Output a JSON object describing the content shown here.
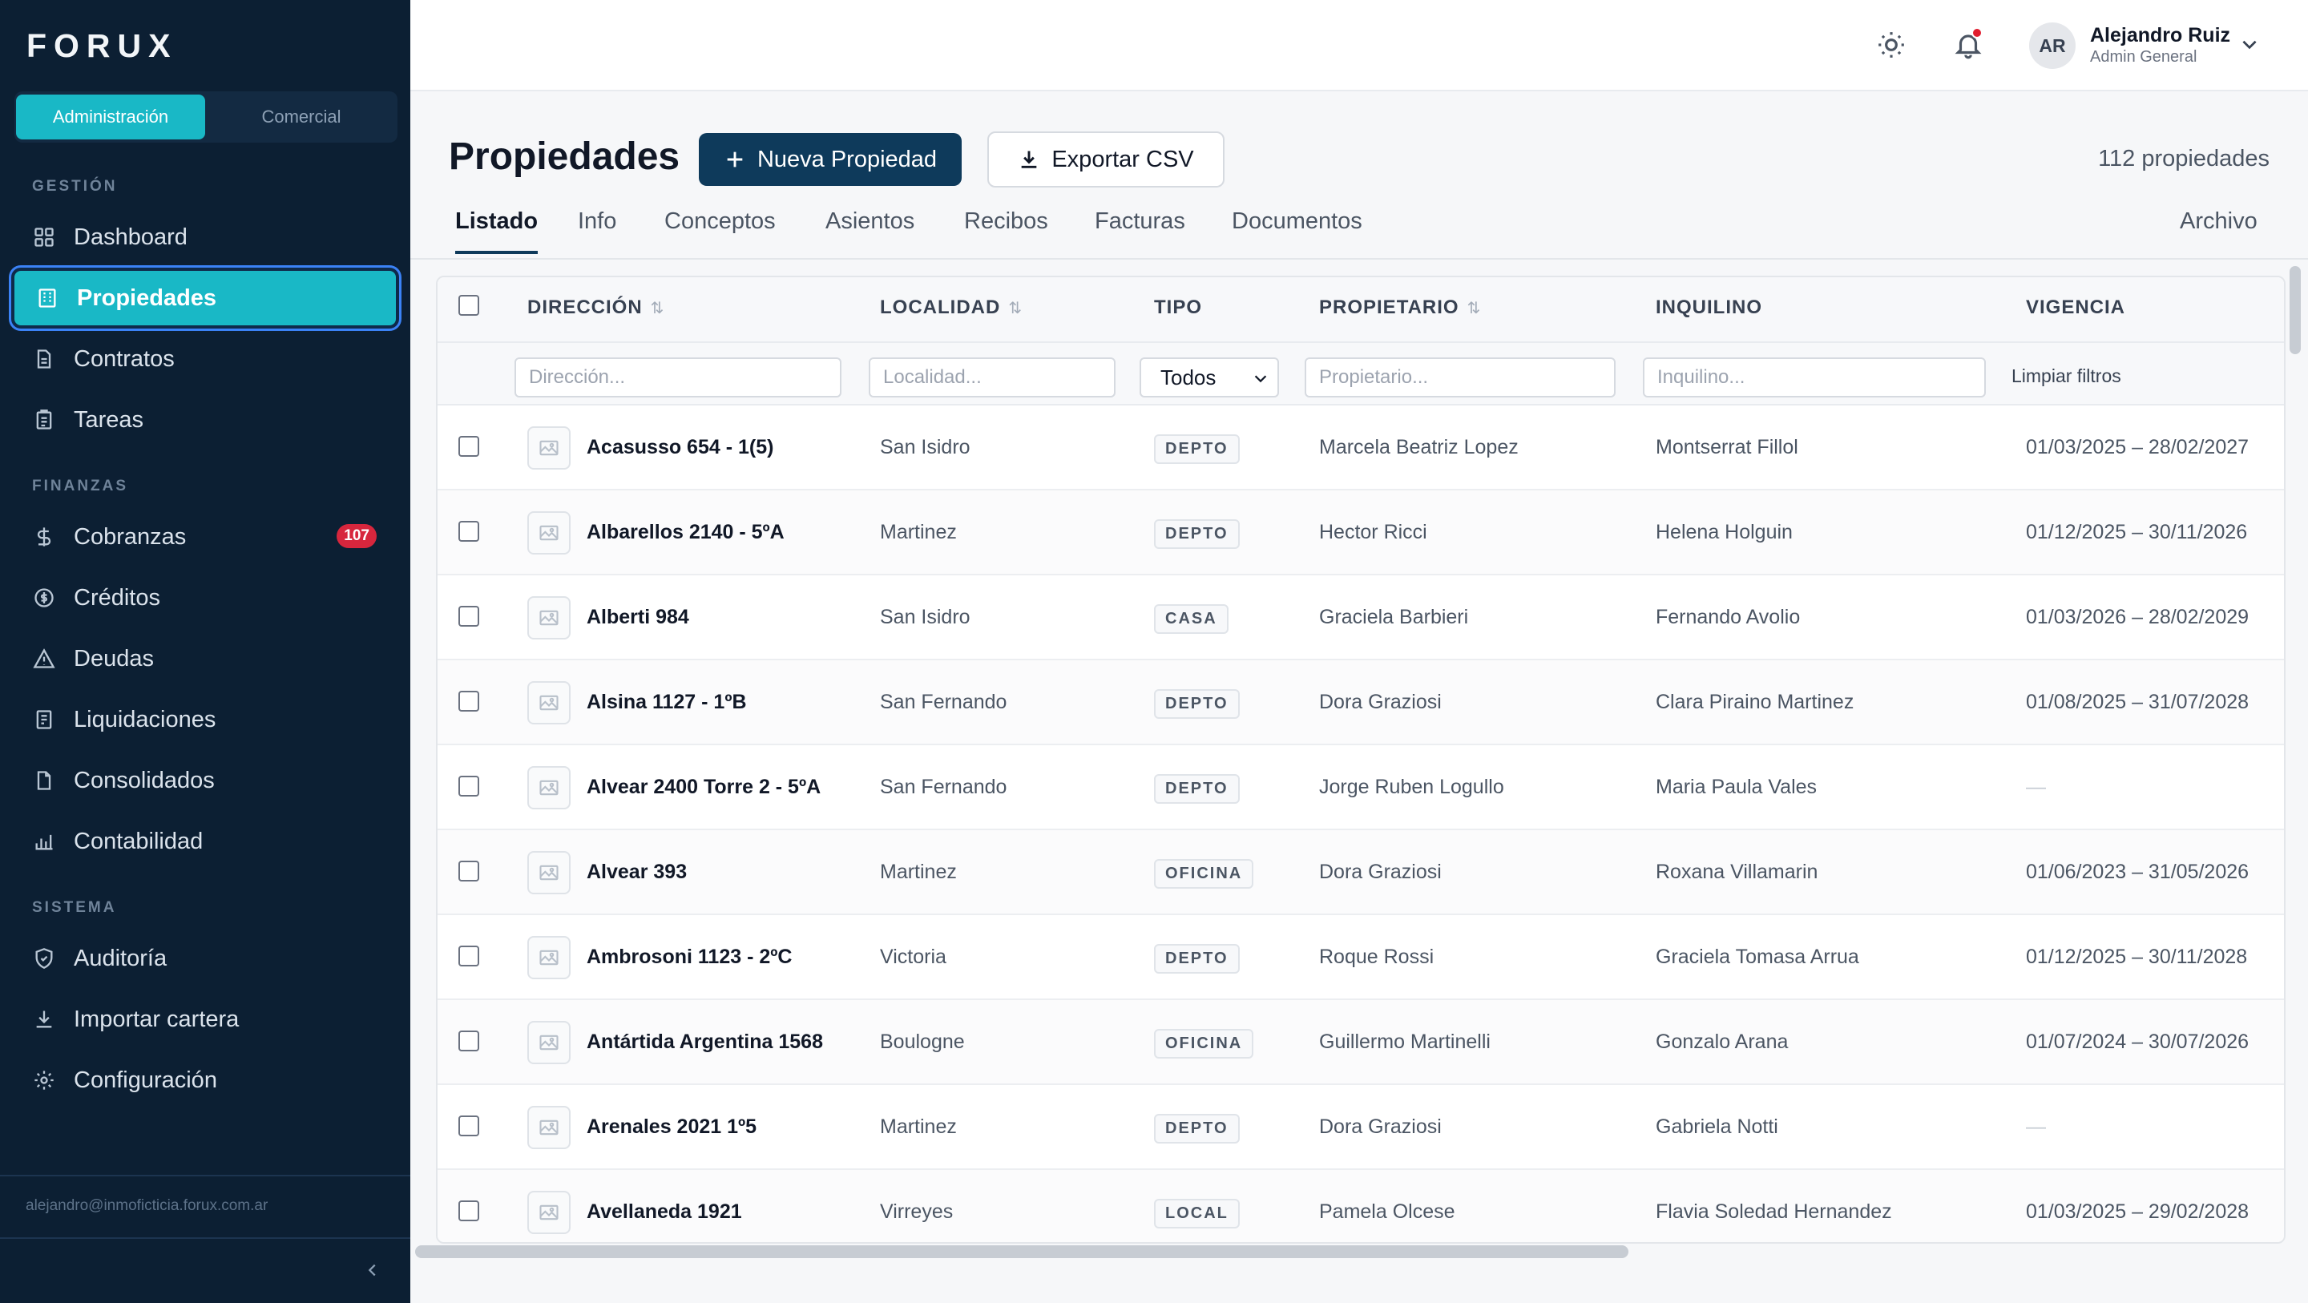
{
  "app": {
    "logo": "FORUX"
  },
  "sidebar": {
    "segments": [
      {
        "label": "Administración"
      },
      {
        "label": "Comercial"
      }
    ],
    "sections": {
      "gestion": "GESTIÓN",
      "finanzas": "FINANZAS",
      "sistema": "SISTEMA"
    },
    "items": [
      {
        "label": "Dashboard",
        "icon": "grid-icon"
      },
      {
        "label": "Propiedades",
        "icon": "building-icon"
      },
      {
        "label": "Contratos",
        "icon": "document-icon"
      },
      {
        "label": "Tareas",
        "icon": "clipboard-icon"
      },
      {
        "label": "Cobranzas",
        "icon": "dollar-icon",
        "badge": "107"
      },
      {
        "label": "Créditos",
        "icon": "coin-icon"
      },
      {
        "label": "Deudas",
        "icon": "warning-icon"
      },
      {
        "label": "Liquidaciones",
        "icon": "receipt-icon"
      },
      {
        "label": "Consolidados",
        "icon": "file-icon"
      },
      {
        "label": "Contabilidad",
        "icon": "bar-chart-icon"
      },
      {
        "label": "Auditoría",
        "icon": "shield-icon"
      },
      {
        "label": "Importar cartera",
        "icon": "download-icon"
      },
      {
        "label": "Configuración",
        "icon": "gear-icon"
      }
    ],
    "email": "alejandro@inmoficticia.forux.com.ar"
  },
  "user": {
    "initials": "AR",
    "name": "Alejandro Ruiz",
    "role": "Admin General"
  },
  "page": {
    "title": "Propiedades",
    "new_button": "Nueva Propiedad",
    "export_button": "Exportar CSV",
    "count": "112 propiedades"
  },
  "tabs": [
    "Listado",
    "Info",
    "Conceptos",
    "Asientos",
    "Recibos",
    "Facturas",
    "Documentos"
  ],
  "archive_tab": "Archivo",
  "table": {
    "columns": [
      "DIRECCIÓN",
      "LOCALIDAD",
      "TIPO",
      "PROPIETARIO",
      "INQUILINO",
      "VIGENCIA"
    ],
    "filters": {
      "direccion": "Dirección...",
      "localidad": "Localidad...",
      "tipo": "Todos",
      "propietario": "Propietario...",
      "inquilino": "Inquilino...",
      "clear": "Limpiar filtros"
    },
    "rows": [
      {
        "direccion": "Acasusso 654 - 1(5)",
        "localidad": "San Isidro",
        "tipo": "DEPTO",
        "propietario": "Marcela Beatriz Lopez",
        "inquilino": "Montserrat Fillol",
        "vigencia": "01/03/2025 – 28/02/2027"
      },
      {
        "direccion": "Albarellos 2140 - 5ºA",
        "localidad": "Martinez",
        "tipo": "DEPTO",
        "propietario": "Hector Ricci",
        "inquilino": "Helena Holguin",
        "vigencia": "01/12/2025 – 30/11/2026"
      },
      {
        "direccion": "Alberti 984",
        "localidad": "San Isidro",
        "tipo": "CASA",
        "propietario": "Graciela Barbieri",
        "inquilino": "Fernando Avolio",
        "vigencia": "01/03/2026 – 28/02/2029"
      },
      {
        "direccion": "Alsina 1127 - 1ºB",
        "localidad": "San Fernando",
        "tipo": "DEPTO",
        "propietario": "Dora Graziosi",
        "inquilino": "Clara Piraino Martinez",
        "vigencia": "01/08/2025 – 31/07/2028"
      },
      {
        "direccion": "Alvear 2400 Torre 2 - 5ºA",
        "localidad": "San Fernando",
        "tipo": "DEPTO",
        "propietario": "Jorge Ruben Logullo",
        "inquilino": "Maria Paula Vales",
        "vigencia": "—"
      },
      {
        "direccion": "Alvear 393",
        "localidad": "Martinez",
        "tipo": "OFICINA",
        "propietario": "Dora Graziosi",
        "inquilino": "Roxana Villamarin",
        "vigencia": "01/06/2023 – 31/05/2026"
      },
      {
        "direccion": "Ambrosoni 1123 - 2ºC",
        "localidad": "Victoria",
        "tipo": "DEPTO",
        "propietario": "Roque Rossi",
        "inquilino": "Graciela Tomasa Arrua",
        "vigencia": "01/12/2025 – 30/11/2028"
      },
      {
        "direccion": "Antártida Argentina 1568",
        "localidad": "Boulogne",
        "tipo": "OFICINA",
        "propietario": "Guillermo Martinelli",
        "inquilino": "Gonzalo Arana",
        "vigencia": "01/07/2024 – 30/07/2026"
      },
      {
        "direccion": "Arenales 2021 1º5",
        "localidad": "Martinez",
        "tipo": "DEPTO",
        "propietario": "Dora Graziosi",
        "inquilino": "Gabriela Notti",
        "vigencia": "—"
      },
      {
        "direccion": "Avellaneda 1921",
        "localidad": "Virreyes",
        "tipo": "LOCAL",
        "propietario": "Pamela Olcese",
        "inquilino": "Flavia Soledad Hernandez",
        "vigencia": "01/03/2025 – 29/02/2028"
      }
    ]
  }
}
